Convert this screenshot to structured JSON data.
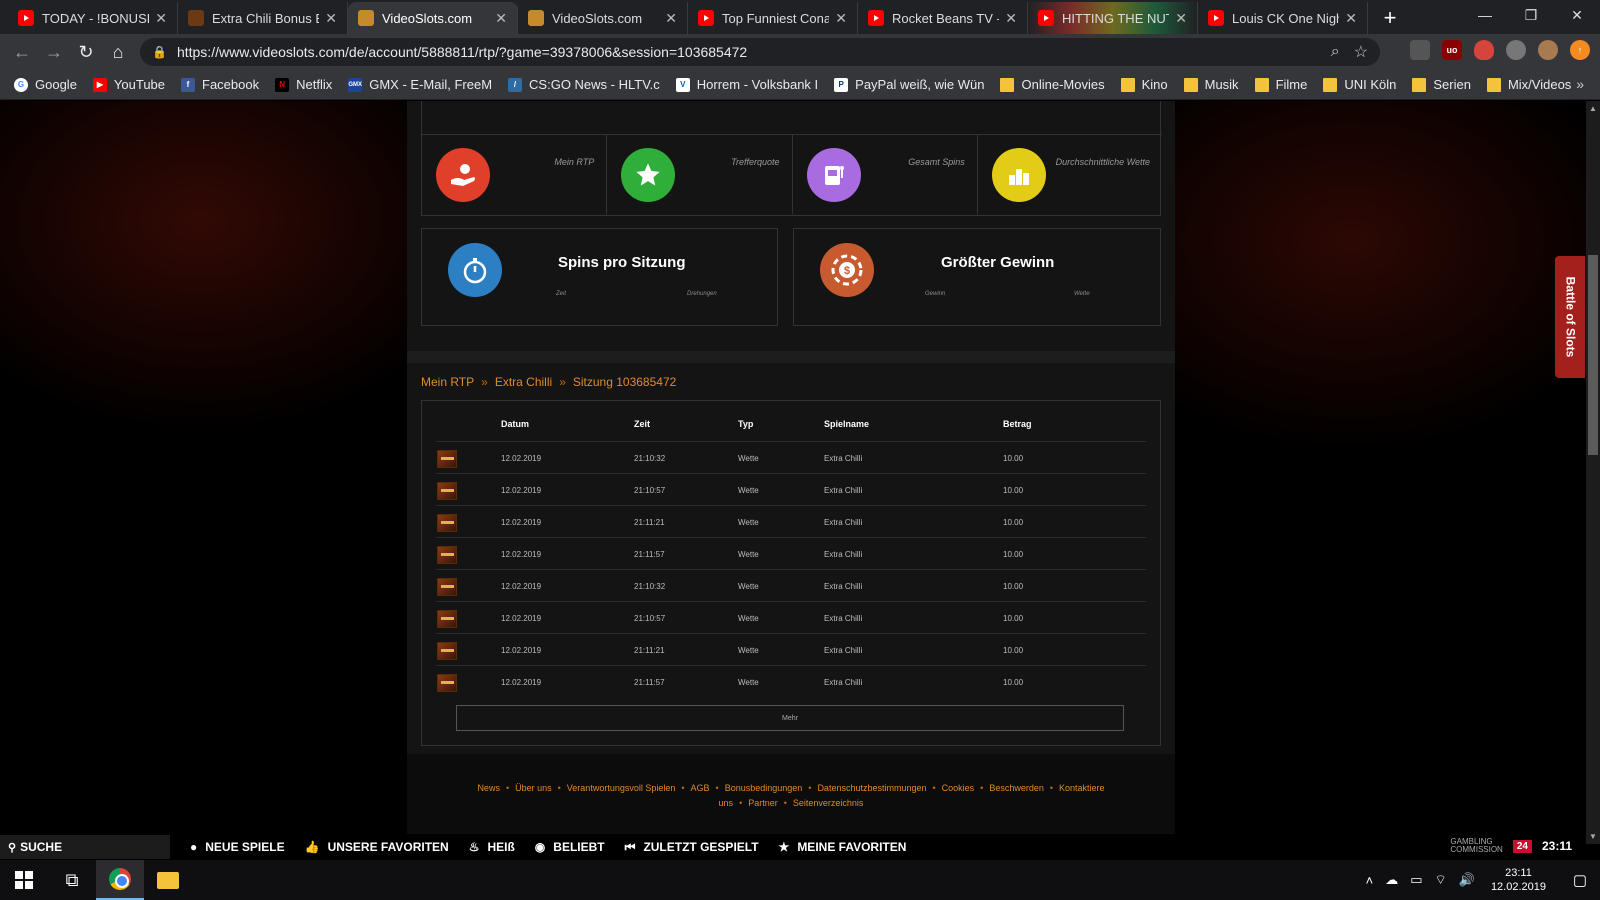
{
  "browser": {
    "tabs": [
      {
        "title": "TODAY - !BONUSHU",
        "icon": "youtube-icon",
        "active": false
      },
      {
        "title": "Extra Chili Bonus Bu",
        "icon": "extra-chili-icon",
        "active": false
      },
      {
        "title": "VideoSlots.com",
        "icon": "videoslots-icon",
        "active": true
      },
      {
        "title": "VideoSlots.com",
        "icon": "videoslots-icon",
        "active": false
      },
      {
        "title": "Top Funniest Conan",
        "icon": "youtube-icon",
        "active": false
      },
      {
        "title": "Rocket Beans TV - Y",
        "icon": "youtube-icon",
        "active": false
      },
      {
        "title": "HITTING THE NUTTI",
        "icon": "youtube-icon",
        "active": false
      },
      {
        "title": "Louis CK One Night",
        "icon": "youtube-icon",
        "active": false
      }
    ],
    "url": "https://www.videoslots.com/de/account/5888811/rtp/?game=39378006&session=103685472",
    "bookmarks": [
      {
        "label": "Google",
        "icon": "google-icon"
      },
      {
        "label": "YouTube",
        "icon": "youtube-icon"
      },
      {
        "label": "Facebook",
        "icon": "facebook-icon"
      },
      {
        "label": "Netflix",
        "icon": "netflix-icon"
      },
      {
        "label": "GMX - E-Mail, FreeM",
        "icon": "gmx-icon"
      },
      {
        "label": "CS:GO News - HLTV.c",
        "icon": "hltv-icon"
      },
      {
        "label": "Horrem - Volksbank I",
        "icon": "volksbank-icon"
      },
      {
        "label": "PayPal weiß, wie Wün",
        "icon": "paypal-icon"
      },
      {
        "label": "Online-Movies",
        "icon": "folder-icon"
      },
      {
        "label": "Kino",
        "icon": "folder-icon"
      },
      {
        "label": "Musik",
        "icon": "folder-icon"
      },
      {
        "label": "Filme",
        "icon": "folder-icon"
      },
      {
        "label": "UNI Köln",
        "icon": "folder-icon"
      },
      {
        "label": "Serien",
        "icon": "folder-icon"
      },
      {
        "label": "Mix/Videos",
        "icon": "folder-icon"
      }
    ]
  },
  "stats": {
    "cells": [
      {
        "label": "Mein RTP",
        "icon": "hand-coin-icon",
        "color": "#e0402a"
      },
      {
        "label": "Trefferquote",
        "icon": "star-icon",
        "color": "#2fae3a"
      },
      {
        "label": "Gesamt Spins",
        "icon": "slot-machine-icon",
        "color": "#a86be0"
      },
      {
        "label": "Durchschnittliche Wette",
        "icon": "coin-stack-icon",
        "color": "#e2cc18"
      }
    ],
    "spins_box": {
      "title": "Spins pro Sitzung",
      "sub_left": "Zeit",
      "sub_right": "Drehungen",
      "icon": "stopwatch-icon",
      "color": "#2d7fc4"
    },
    "win_box": {
      "title": "Größter Gewinn",
      "sub_left": "Gewinn",
      "sub_right": "Wette",
      "icon": "casino-chip-icon",
      "color": "#c85a30"
    }
  },
  "breadcrumb": [
    "Mein RTP",
    "Extra Chilli",
    "Sitzung 103685472"
  ],
  "table": {
    "headers": [
      "Datum",
      "Zeit",
      "Typ",
      "Spielname",
      "Betrag"
    ],
    "rows": [
      [
        "12.02.2019",
        "21:10:32",
        "Wette",
        "Extra Chilli",
        "10.00"
      ],
      [
        "12.02.2019",
        "21:10:57",
        "Wette",
        "Extra Chilli",
        "10.00"
      ],
      [
        "12.02.2019",
        "21:11:21",
        "Wette",
        "Extra Chilli",
        "10.00"
      ],
      [
        "12.02.2019",
        "21:11:57",
        "Wette",
        "Extra Chilli",
        "10.00"
      ],
      [
        "12.02.2019",
        "21:10:32",
        "Wette",
        "Extra Chilli",
        "10.00"
      ],
      [
        "12.02.2019",
        "21:10:57",
        "Wette",
        "Extra Chilli",
        "10.00"
      ],
      [
        "12.02.2019",
        "21:11:21",
        "Wette",
        "Extra Chilli",
        "10.00"
      ],
      [
        "12.02.2019",
        "21:11:57",
        "Wette",
        "Extra Chilli",
        "10.00"
      ]
    ],
    "more_label": "Mehr"
  },
  "footer_links": [
    "News",
    "Über uns",
    "Verantwortungsvoll Spielen",
    "AGB",
    "Bonusbedingungen",
    "Datenschutzbestimmungen",
    "Cookies",
    "Beschwerden",
    "Kontaktiere uns",
    "Partner",
    "Seitenverzeichnis"
  ],
  "side_tab": "Battle of Slots",
  "sitebar": {
    "search": "SUCHE",
    "nav": [
      {
        "label": "NEUE SPIELE",
        "icon": "new-games-icon"
      },
      {
        "label": "UNSERE FAVORITEN",
        "icon": "thumbs-up-icon"
      },
      {
        "label": "HEIß",
        "icon": "flame-icon"
      },
      {
        "label": "BELIEBT",
        "icon": "popular-icon"
      },
      {
        "label": "ZULETZT GESPIELT",
        "icon": "rewind-icon"
      },
      {
        "label": "MEINE FAVORITEN",
        "icon": "star-icon"
      }
    ],
    "gambling_commission_line1": "GAMBLING",
    "gambling_commission_line2": "COMMISSION",
    "badge": "24",
    "clock": "23:11"
  },
  "taskbar": {
    "time": "23:11",
    "date": "12.02.2019"
  }
}
